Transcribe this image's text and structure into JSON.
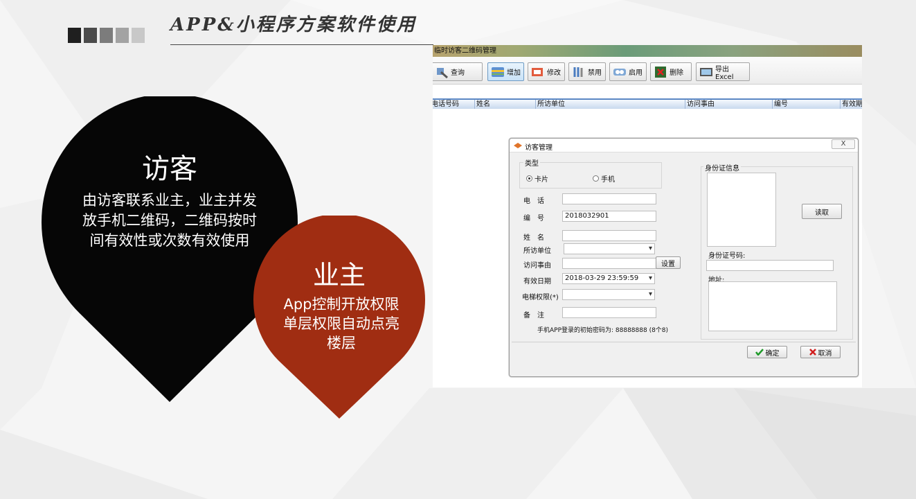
{
  "slide": {
    "title": "APP&小程序方案软件使用",
    "square_colors": [
      "#1f1f1f",
      "#4b4b4b",
      "#7c7c7c",
      "#a3a3a3",
      "#c8c8c8"
    ]
  },
  "pins": {
    "visitor": {
      "title": "访客",
      "desc": "由访客联系业主，业主并发放手机二维码，二维码按时间有效性或次数有效使用",
      "color": "#060606"
    },
    "owner": {
      "title": "业主",
      "desc": "App控制开放权限单层权限自动点亮楼层",
      "color": "#a02d12"
    }
  },
  "app": {
    "window_title": "临时访客二维码管理",
    "toolbar": [
      {
        "label": "查询",
        "icon": "search-wrench-icon"
      },
      {
        "label": "增加",
        "icon": "add-card-icon",
        "active": true
      },
      {
        "label": "修改",
        "icon": "edit-card-icon"
      },
      {
        "label": "禁用",
        "icon": "disable-tools-icon"
      },
      {
        "label": "启用",
        "icon": "enable-card-icon"
      },
      {
        "label": "删除",
        "icon": "delete-icon"
      },
      {
        "label": "导出Excel",
        "icon": "export-excel-icon"
      }
    ],
    "columns": [
      "电话号码",
      "姓名",
      "所访单位",
      "访问事由",
      "编号",
      "有效期"
    ]
  },
  "dialog": {
    "title": "访客管理",
    "close_label": "X",
    "type_group": {
      "label": "类型",
      "options": [
        "卡片",
        "手机"
      ],
      "selected": "卡片"
    },
    "fields": {
      "phone": {
        "label": "电　话",
        "value": ""
      },
      "number": {
        "label": "编　号",
        "value": "2018032901"
      },
      "name": {
        "label": "姓　名",
        "value": ""
      },
      "unit": {
        "label": "所访单位",
        "value": ""
      },
      "reason": {
        "label": "访问事由",
        "value": ""
      },
      "valid_date": {
        "label": "有效日期",
        "value": "2018-03-29 23:59:59"
      },
      "elevator": {
        "label": "电梯权限(*)",
        "value": ""
      },
      "remark": {
        "label": "备　注",
        "value": ""
      }
    },
    "set_button": "设置",
    "hint": "手机APP登录的初始密码为: 88888888 (8个8)",
    "id_group_label": "身份证信息",
    "read_button": "读取",
    "id_number_label": "身份证号码:",
    "id_number_value": "",
    "address_label": "地址:",
    "address_value": "",
    "ok_button": "确定",
    "cancel_button": "取消"
  }
}
